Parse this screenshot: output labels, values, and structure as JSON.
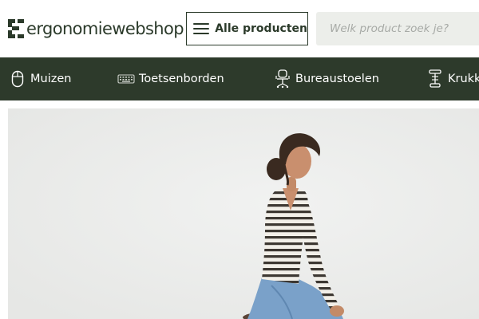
{
  "header": {
    "logo_text": "ergonomiewebshop",
    "all_products_label": "Alle producten",
    "search_placeholder": "Welk product zoek je?"
  },
  "categories": [
    {
      "label": "Muizen",
      "icon": "mouse-icon"
    },
    {
      "label": "Toetsenborden",
      "icon": "keyboard-icon"
    },
    {
      "label": "Bureaustoelen",
      "icon": "office-chair-icon"
    },
    {
      "label": "Krukk",
      "icon": "stool-icon"
    }
  ],
  "hero": {
    "image": "woman-sitting-on-stool-photo"
  },
  "colors": {
    "brand": "#2b3a2a",
    "category_bar": "#2d3a2b",
    "search_bg": "#eceeea"
  }
}
